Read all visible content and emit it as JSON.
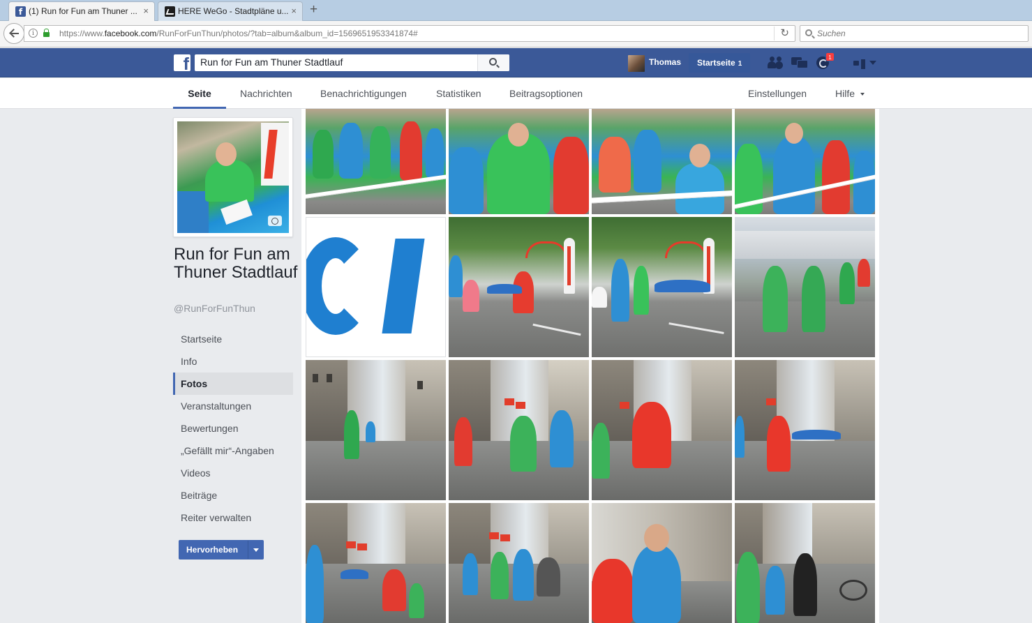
{
  "browser": {
    "tabs": [
      {
        "title": "(1) Run for Fun am Thuner ...",
        "active": true,
        "favicon": "facebook-icon"
      },
      {
        "title": "HERE WeGo - Stadtpläne u...",
        "active": false,
        "favicon": "here-wego-icon"
      }
    ],
    "close_glyph": "×",
    "newtab_glyph": "+",
    "url_prefix": "https://www.",
    "url_domain": "facebook.com",
    "url_rest": "/RunForFunThun/photos/?tab=album&album_id=1569651953341874#",
    "reload_glyph": "↻",
    "search_placeholder": "Suchen",
    "info_glyph": "i"
  },
  "fb": {
    "logo_glyph": "f",
    "search_value": "Run for Fun am Thuner Stadtlauf",
    "user_name": "Thomas",
    "home_label": "Startseite",
    "home_count": "1",
    "notification_count": "1",
    "brand_color": "#3b5998"
  },
  "page_tabs": {
    "seite": "Seite",
    "nachrichten": "Nachrichten",
    "benachrichtigungen": "Benachrichtigungen",
    "statistiken": "Statistiken",
    "beitragsoptionen": "Beitragsoptionen",
    "einstellungen": "Einstellungen",
    "hilfe": "Hilfe"
  },
  "page": {
    "name": "Run for Fun am Thuner Stadtlauf",
    "handle": "@RunForFunThun",
    "nav": [
      {
        "label": "Startseite",
        "active": false
      },
      {
        "label": "Info",
        "active": false
      },
      {
        "label": "Fotos",
        "active": true
      },
      {
        "label": "Veranstaltungen",
        "active": false
      },
      {
        "label": "Bewertungen",
        "active": false
      },
      {
        "label": "„Gefällt mir“-Angaben",
        "active": false
      },
      {
        "label": "Videos",
        "active": false
      },
      {
        "label": "Beiträge",
        "active": false
      },
      {
        "label": "Reiter verwalten",
        "active": false
      }
    ],
    "promote_label": "Hervorheben"
  },
  "photos": {
    "count": 16,
    "logo_text": "CI"
  }
}
